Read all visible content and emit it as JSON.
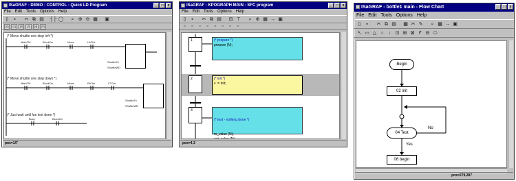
{
  "win1": {
    "title": "ISaGRAF - DEMO : CONTROL - Quick LD Program",
    "menus": [
      "File",
      "Edit",
      "Tools",
      "Options",
      "Help"
    ],
    "toolbar2": [
      "[0]",
      "[1]",
      "[2]",
      "[3]",
      "[4]",
      "[5]"
    ],
    "comments": [
      "(* Move shuttle one step left *)",
      "(* Move shuttle one step down *)",
      "(* Just wait until fan test done *)"
    ],
    "contacts_row1": [
      "MainTM",
      "BlockOn",
      "Move",
      "LftChk"
    ],
    "contacts_row2": [
      "MainTM",
      "BlockOn",
      "Move",
      "RtChk",
      "LTChk"
    ],
    "contacts_row3": [
      "Busy",
      "BlockOn"
    ],
    "fb1_outputs": [
      "ShuttleTo",
      "ShuttleWD"
    ],
    "fb2_outputs": [
      "ShuttleTo",
      "ShuttleWD"
    ],
    "status": "pos=1/7"
  },
  "win2": {
    "title": "ISaGRAF - KPOGRAPH MAIN - SFC program",
    "menus": [
      "File",
      "Edit",
      "Tools",
      "Options",
      "Help"
    ],
    "steps": [
      {
        "num": "1",
        "comment": "(* prepare *)",
        "code": "prepare (N);"
      },
      {
        "num": "2",
        "comment": "(* init *)",
        "code": "s := init;"
      },
      {
        "num": "3",
        "comment": "(* test - nothing done *)",
        "code": "m_value (N);\nout_value (N);\nstart (N);"
      }
    ],
    "status": "pos=4,3"
  },
  "win3": {
    "title": "ISaGRAF - bottle1 main - Flow Chart",
    "menus": [
      "File",
      "Edit",
      "Tools",
      "Options",
      "Help"
    ],
    "nodes": {
      "begin": "Begin",
      "init": "02 init",
      "test": "04 Test",
      "begin2": "06 begin"
    },
    "branch_no": "No",
    "branch_yes": "Yes",
    "status": "pos=279,287"
  },
  "colors": {
    "titlebar": "#000080",
    "window_face": "#c0c0c0",
    "sfc_action_cyan": "#66e0e8",
    "sfc_action_yellow": "#fbf6a0"
  }
}
